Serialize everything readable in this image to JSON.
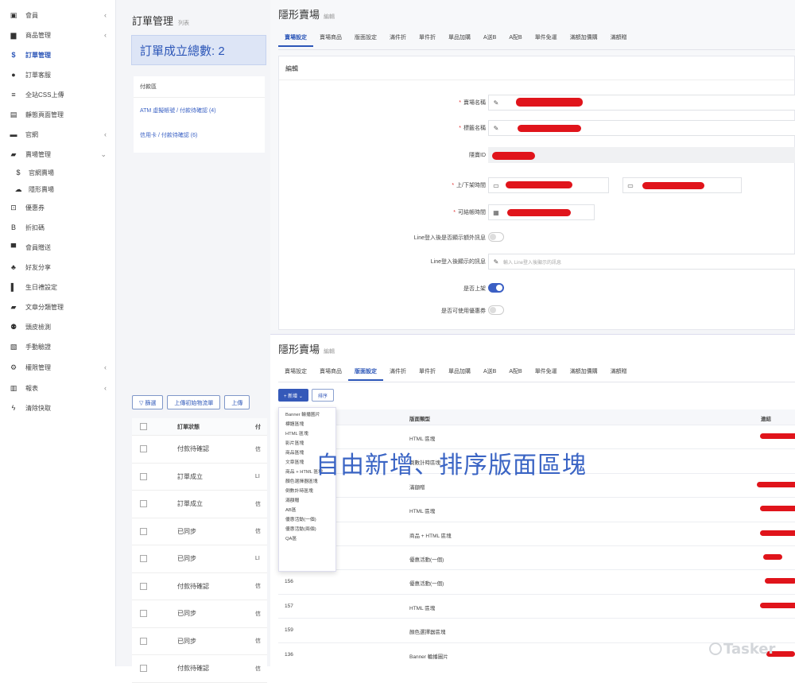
{
  "sidebar": {
    "items": [
      {
        "icon": "member-icon",
        "glyph": "▣",
        "label": "會員",
        "chevron": "‹"
      },
      {
        "icon": "shop-icon",
        "glyph": "▆",
        "label": "商品管理",
        "chevron": "‹"
      },
      {
        "icon": "dollar-icon",
        "glyph": "$",
        "label": "訂單管理",
        "chevron": "",
        "active": true
      },
      {
        "icon": "bomb-icon",
        "glyph": "●",
        "label": "訂單客服",
        "chevron": ""
      },
      {
        "icon": "css-icon",
        "glyph": "≡",
        "label": "全站CSS上傳",
        "chevron": ""
      },
      {
        "icon": "static-page-icon",
        "glyph": "▤",
        "label": "靜態頁面管理",
        "chevron": ""
      },
      {
        "icon": "briefcase-icon",
        "glyph": "▬",
        "label": "官網",
        "chevron": "‹"
      },
      {
        "icon": "truck-icon",
        "glyph": "▰",
        "label": "賣場管理",
        "chevron": "⌄"
      },
      {
        "icon": "dollar-small-icon",
        "glyph": "$",
        "label": "官網賣場",
        "chevron": "",
        "sub": true
      },
      {
        "icon": "cloud-icon",
        "glyph": "☁",
        "label": "隱形賣場",
        "chevron": "",
        "sub": true
      },
      {
        "icon": "coupon-icon",
        "glyph": "⊡",
        "label": "優惠券",
        "chevron": ""
      },
      {
        "icon": "bitcoin-icon",
        "glyph": "B",
        "label": "折扣碼",
        "chevron": ""
      },
      {
        "icon": "gift-icon",
        "glyph": "▀",
        "label": "會員贈送",
        "chevron": ""
      },
      {
        "icon": "users-icon",
        "glyph": "♣",
        "label": "好友分享",
        "chevron": ""
      },
      {
        "icon": "birthday-icon",
        "glyph": "▌",
        "label": "生日禮設定",
        "chevron": ""
      },
      {
        "icon": "book-icon",
        "glyph": "▰",
        "label": "文章分類管理",
        "chevron": ""
      },
      {
        "icon": "monitor-icon",
        "glyph": "⚉",
        "label": "頭皮檢測",
        "chevron": ""
      },
      {
        "icon": "id-card-icon",
        "glyph": "▧",
        "label": "手動驗證",
        "chevron": ""
      },
      {
        "icon": "gear-icon",
        "glyph": "⚙",
        "label": "權限管理",
        "chevron": "‹"
      },
      {
        "icon": "chart-icon",
        "glyph": "▥",
        "label": "報表",
        "chevron": "‹"
      },
      {
        "icon": "bolt-icon",
        "glyph": "ϟ",
        "label": "清除快取",
        "chevron": ""
      }
    ]
  },
  "orders": {
    "title": "訂單管理",
    "subtitle": "列表",
    "total_label": "訂單成立總數: 2",
    "pay_header": "付款區",
    "pay_items": [
      "ATM 虛擬帳號 / 付款待確認 (4)",
      "信用卡 / 付款待確認 (6)"
    ],
    "filter_buttons": [
      "▽ 篩選",
      "上傳初始物流單",
      "上傳"
    ],
    "table_header": {
      "status": "訂單狀態",
      "pay": "付"
    },
    "rows": [
      {
        "status": "付款待確認",
        "pay": "信"
      },
      {
        "status": "訂單成立",
        "pay": "LI"
      },
      {
        "status": "訂單成立",
        "pay": "信"
      },
      {
        "status": "已同步",
        "pay": "信"
      },
      {
        "status": "已同步",
        "pay": "LI"
      },
      {
        "status": "付款待確認",
        "pay": "信"
      },
      {
        "status": "已同步",
        "pay": "信"
      },
      {
        "status": "已同步",
        "pay": "信"
      },
      {
        "status": "付款待確認",
        "pay": "信"
      }
    ]
  },
  "panel1": {
    "title": "隱形賣場",
    "subtitle": "編輯",
    "tabs": [
      "賣場設定",
      "賣場商品",
      "版面設定",
      "滿件折",
      "單件折",
      "單品加購",
      "A送B",
      "A配B",
      "單件免運",
      "滿額加價購",
      "滿額贈"
    ],
    "active_tab": 0,
    "section_title": "編輯",
    "fields": {
      "store_name": "賣場名稱",
      "tag_name": "標籤名稱",
      "hidden_id": "隱賣ID",
      "schedule": "上/下架時間",
      "checkout_time": "可結帳時間",
      "line_extra": "Line登入後是否顯示額外訊息",
      "line_msg": "Line登入後顯示的訊息",
      "line_msg_placeholder": "輸入 Line登入後顯示的訊息",
      "is_listed": "是否上架",
      "coupon_allowed": "是否可使用優惠券"
    },
    "toggles": {
      "line_extra": false,
      "is_listed": true,
      "coupon_allowed": false
    }
  },
  "panel2": {
    "title": "隱形賣場",
    "subtitle": "編輯",
    "tabs": [
      "賣場設定",
      "賣場商品",
      "版面設定",
      "滿件折",
      "單件折",
      "單品加購",
      "A送B",
      "A配B",
      "單件免運",
      "滿額加價購",
      "滿額贈"
    ],
    "active_tab": 2,
    "add_button": "+ 新增  ⌄",
    "sort_button": "排序",
    "table_header": {
      "type": "版面類型",
      "action": "連結"
    },
    "rows": [
      {
        "id": "",
        "type": "HTML 區塊"
      },
      {
        "id": "",
        "type": "倒數計時區塊"
      },
      {
        "id": "",
        "type": "滿額贈"
      },
      {
        "id": "",
        "type": "HTML 區塊"
      },
      {
        "id": "",
        "type": "商品 + HTML 區塊"
      },
      {
        "id": "",
        "type": "優惠活動(一個)"
      },
      {
        "id": "156",
        "type": "優惠活動(一個)"
      },
      {
        "id": "157",
        "type": "HTML 區塊"
      },
      {
        "id": "159",
        "type": "顏色選擇器區塊"
      },
      {
        "id": "136",
        "type": "Banner 輪播圖片"
      }
    ],
    "dropdown": [
      "Banner 輪播圖片",
      "標題區塊",
      "HTML 區塊",
      "影片區塊",
      "商品區塊",
      "文章區塊",
      "商品 + HTML 區塊",
      "顏色選擇器區塊",
      "倒數計時區塊",
      "滿額贈",
      "AB區",
      "優惠活動(一個)",
      "優惠活動(兩個)",
      "QA區"
    ]
  },
  "overlay_caption": "自由新增、排序版面區塊",
  "watermark": "Tasker",
  "colors": {
    "accent": "#2c56b8",
    "redaction": "#e0141b",
    "overlay": "#3a64c4"
  }
}
